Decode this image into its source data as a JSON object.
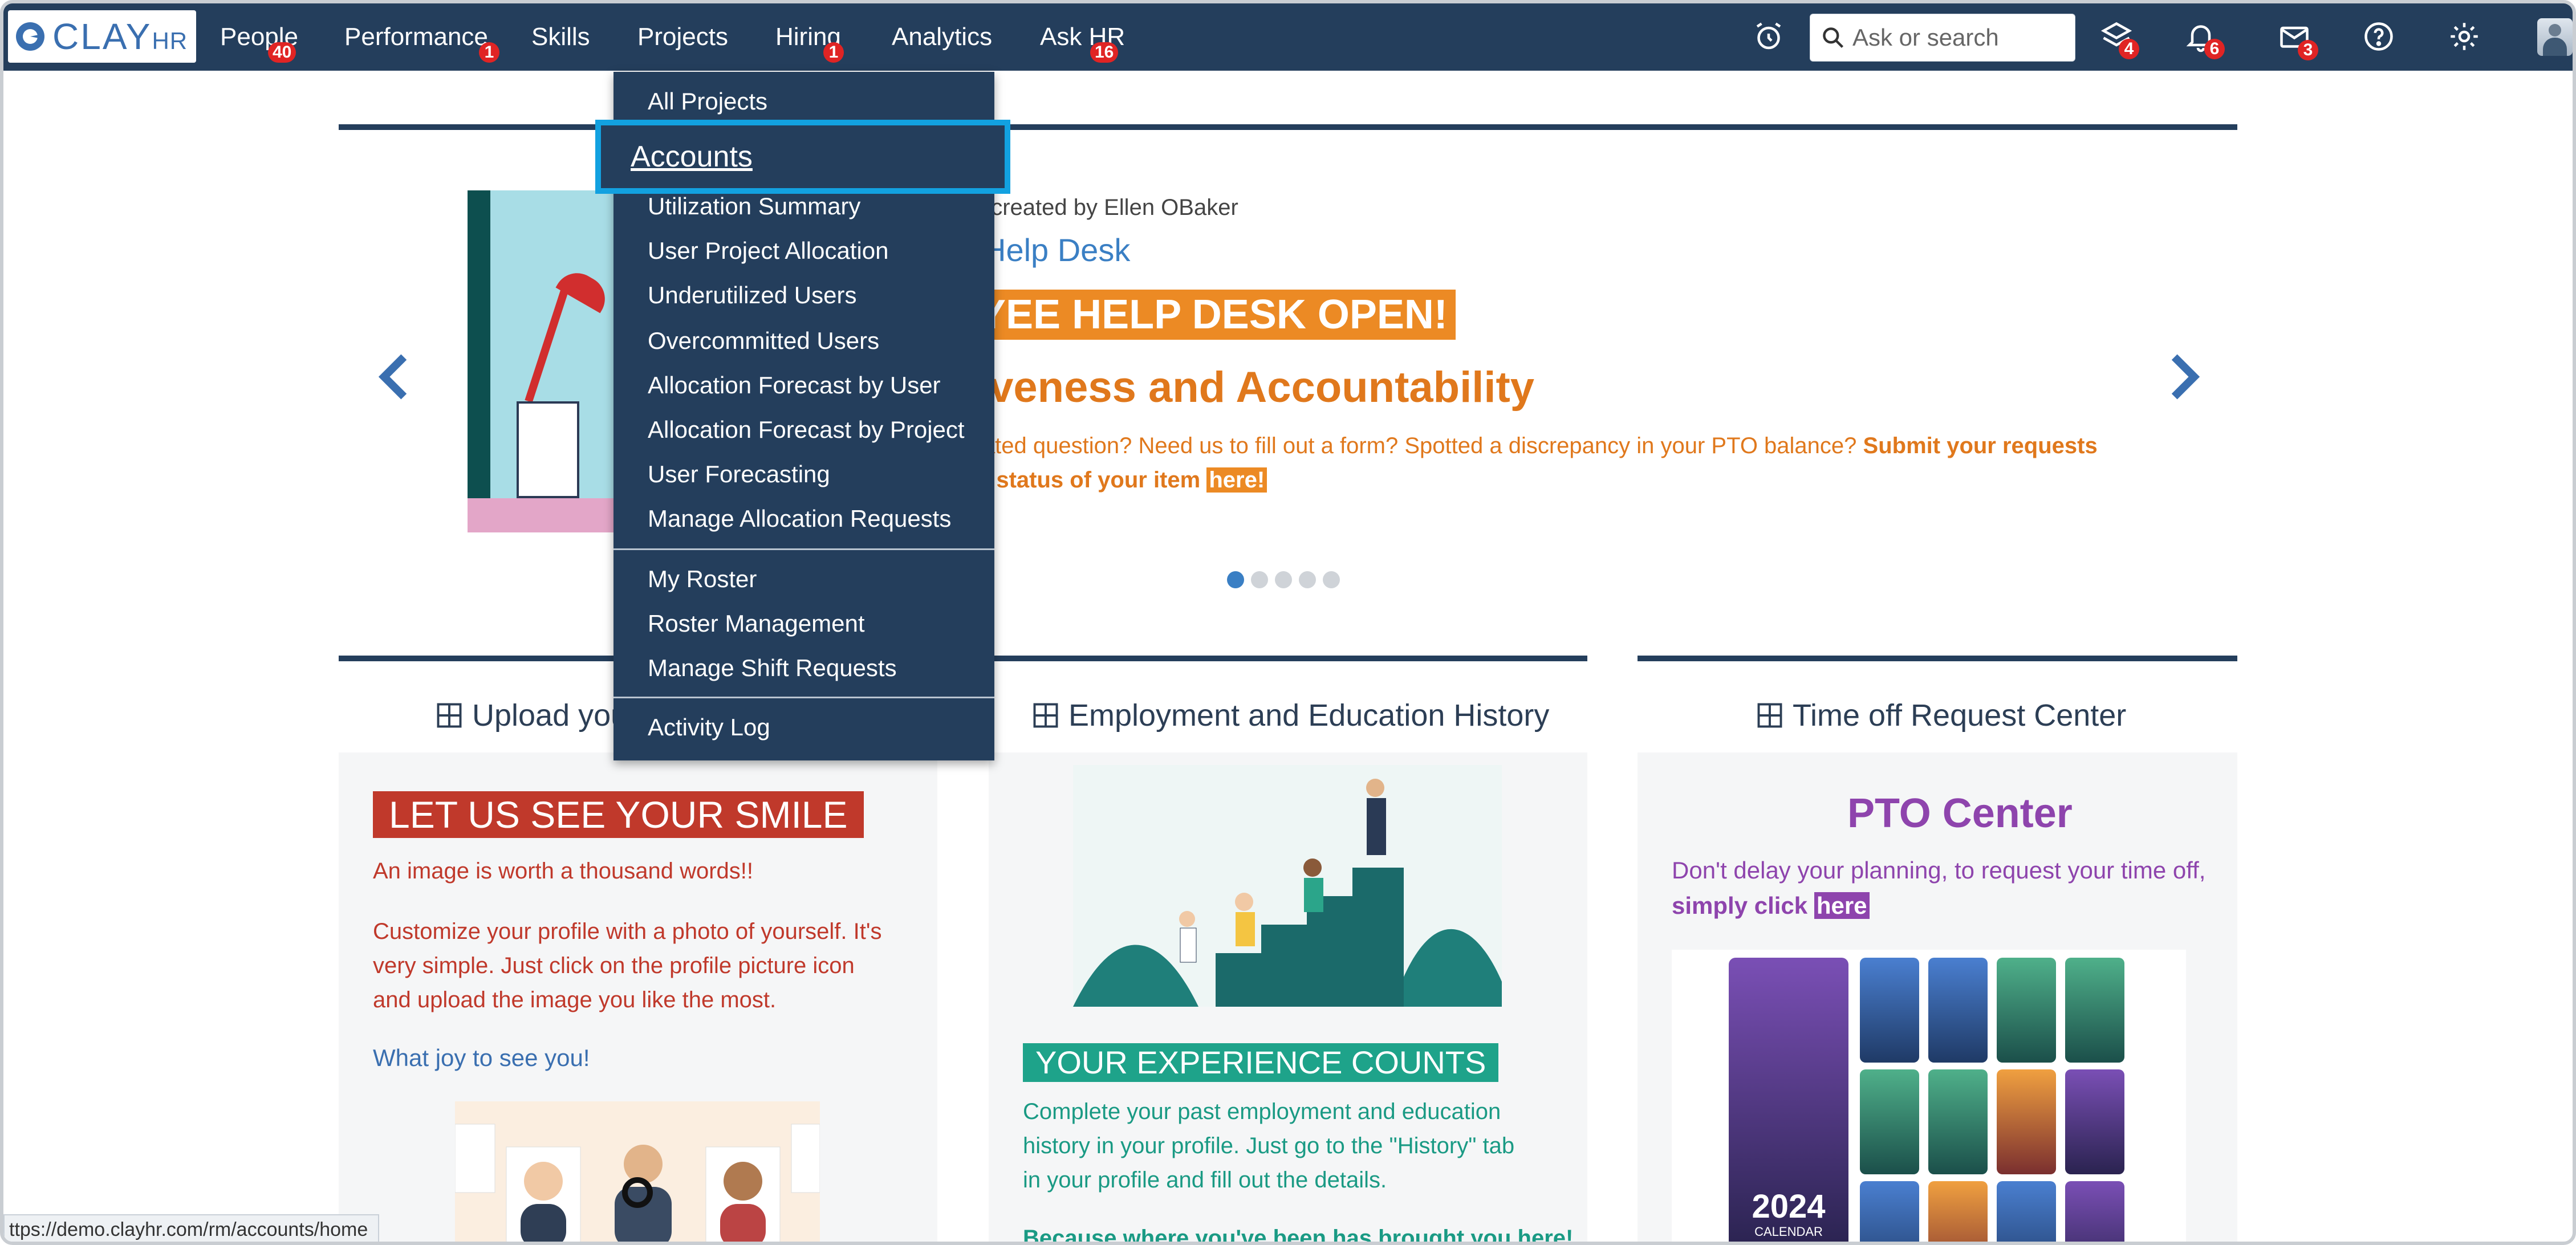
{
  "app": {
    "logo_main": "CLAY",
    "logo_sub": "HR"
  },
  "nav": {
    "items": [
      {
        "label": "People",
        "badge": "40"
      },
      {
        "label": "Performance",
        "badge": "1"
      },
      {
        "label": "Skills",
        "badge": ""
      },
      {
        "label": "Projects",
        "badge": ""
      },
      {
        "label": "Hiring",
        "badge": "1"
      },
      {
        "label": "Analytics",
        "badge": ""
      },
      {
        "label": "Ask HR",
        "badge": "16"
      }
    ],
    "search_placeholder": "Ask or search",
    "icons": [
      {
        "name": "alarm-clock-icon",
        "badge": ""
      },
      {
        "name": "layers-icon",
        "badge": "4"
      },
      {
        "name": "bell-icon",
        "badge": "6"
      },
      {
        "name": "mail-icon",
        "badge": "3"
      },
      {
        "name": "help-icon",
        "badge": ""
      },
      {
        "name": "gear-icon",
        "badge": ""
      }
    ],
    "colors": {
      "bar": "#243e5c",
      "badge": "#e02424"
    }
  },
  "projects_menu": {
    "group1": [
      "All Projects",
      "Accounts",
      "Utilization Summary",
      "User Project Allocation",
      "Underutilized Users",
      "Overcommitted Users",
      "Allocation Forecast by User",
      "Allocation Forecast by Project",
      "User Forecasting",
      "Manage Allocation Requests"
    ],
    "group2": [
      "My Roster",
      "Roster Management",
      "Manage Shift Requests"
    ],
    "group3": [
      "Activity Log"
    ],
    "highlighted": "Accounts",
    "highlight_color": "#12a1e0"
  },
  "carousel": {
    "meta": "t created by Ellen OBaker",
    "category": "Help Desk",
    "headline": "YEE HELP DESK OPEN!",
    "subhead": "iveness and Accountability",
    "blurb_line1": "lated question? Need us to fill out a form? Spotted a discrepancy in your PTO balance?",
    "blurb_bold1": "Submit your requests",
    "blurb_line2_bold": "e status of your item",
    "blurb_link": "here!",
    "dots": 5,
    "active_dot": 0,
    "accent": "#ec8a24"
  },
  "cards": {
    "upload": {
      "title": "Upload you",
      "banner": "LET US SEE YOUR SMILE",
      "line1": "An image is worth a thousand words!!",
      "para1": "Customize your profile with a photo of yourself. It's",
      "para2": "very simple. Just click on the profile picture icon",
      "para3": "and upload the image you like the most.",
      "link": "What joy to see you!"
    },
    "employment": {
      "title": "Employment and Education History",
      "banner": "YOUR EXPERIENCE COUNTS",
      "para1": "Complete your past employment and education",
      "para2": "history in your profile. Just go to the \"History\" tab",
      "para3": "in your profile and fill out the details.",
      "bold": "Because where you've been has brought you here!"
    },
    "timeoff": {
      "title": "Time off Request Center",
      "heading": "PTO Center",
      "line1": "Don't delay your planning, to request your time off,",
      "line2_bold": "simply click",
      "link": "here",
      "calendar_year": "2024",
      "calendar_label": "CALENDAR"
    }
  },
  "status_url": "ttps://demo.clayhr.com/rm/accounts/home"
}
